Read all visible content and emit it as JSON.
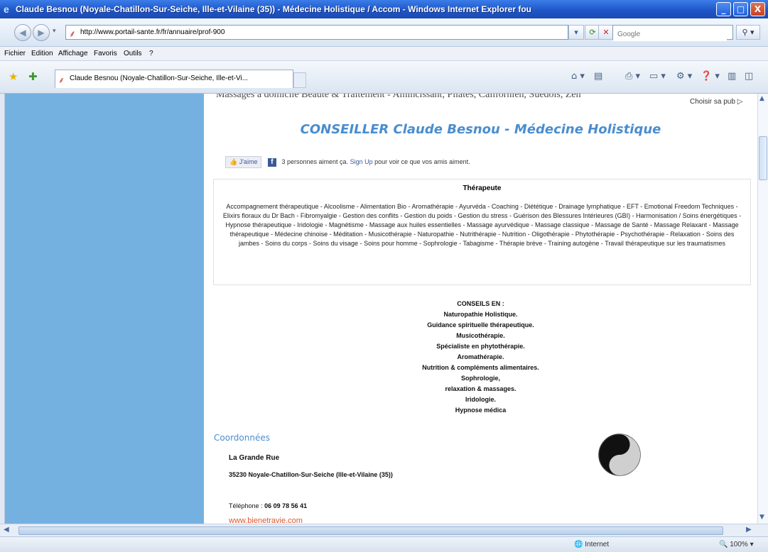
{
  "window": {
    "title": "Claude Besnou (Noyale-Chatillon-Sur-Seiche, Ille-et-Vilaine (35)) - Médecine Holistique / Accom - Windows Internet Explorer fou",
    "minimize": "_",
    "maximize": "□",
    "close": "X"
  },
  "address": {
    "url": "http://www.portail-sante.fr/fr/annuaire/prof-900",
    "search_placeholder": "Google"
  },
  "menu": [
    "Fichier",
    "Edition",
    "Affichage",
    "Favoris",
    "Outils",
    "?"
  ],
  "tab": {
    "label": "Claude Besnou (Noyale-Chatillon-Sur-Seiche, Ille-et-Vi..."
  },
  "ad": {
    "links": "Massages à domicile Beauté & Traitement - Amincissant, Pilates, Californien, Suédois, Zen",
    "choose": "Choisir sa pub ▷"
  },
  "page": {
    "heading": "CONSEILLER Claude Besnou - Médecine Holistique"
  },
  "facebook": {
    "like_button": "J'aime",
    "count_text": "3 personnes aiment ça.",
    "signup_link": "Sign Up",
    "suffix": "pour voir ce que vos amis aiment."
  },
  "therapeute": {
    "heading": "Thérapeute",
    "list": "Accompagnement thérapeutique - Alcoolisme - Alimentation Bio - Aromathérapie - Ayurvéda - Coaching - Diététique - Drainage lymphatique - EFT - Emotional Freedom Techniques - Elixirs floraux du Dr Bach - Fibromyalgie - Gestion des conflits - Gestion du poids - Gestion du stress - Guérison des Blessures Intérieures (GBI) - Harmonisation / Soins énergétiques - Hypnose thérapeutique - Iridologie - Magnétisme - Massage aux huiles essentielles - Massage ayurvédique - Massage classique - Massage de Santé - Massage Relaxant - Massage thérapeutique - Médecine chinoise - Méditation - Musicothérapie - Naturopathie - Nutrithérapie - Nutrition - Oligothérapie - Phytothérapie - Psychothérapie - Relaxation - Soins des jambes - Soins du corps - Soins du visage - Soins pour homme - Sophrologie - Tabagisme - Thérapie brève - Training autogène - Travail thérapeutique sur les traumatismes"
  },
  "conseils": {
    "lines": [
      "CONSEILS EN :",
      "Naturopathie Holistique.",
      "Guidance spirituelle thérapeutique.",
      "Musicothérapie.",
      "Spécialiste en phytothérapie.",
      "Aromathérapie.",
      "Nutrition & compléments alimentaires.",
      "Sophrologie,",
      "relaxation & massages.",
      "Iridologie.",
      "Hypnose médica"
    ]
  },
  "coordonnees": {
    "title": "Coordonnées",
    "street": "La Grande Rue",
    "city": "35230 Noyale-Chatillon-Sur-Seiche (Ille-et-Vilaine (35))",
    "phone_label": "Téléphone :",
    "phone": "06 09 78 56 41",
    "website": "www.bienetravie.com"
  },
  "status": {
    "zone": "Internet",
    "zoom": "100%"
  },
  "icons": {
    "back": "back-arrow-icon",
    "forward": "forward-arrow-icon",
    "refresh": "refresh-icon",
    "stop": "stop-icon",
    "search": "search-icon",
    "favorites": "favorites-star-icon",
    "add_favorites": "add-favorites-icon",
    "yin_yang": "yin-yang-icon"
  },
  "colors": {
    "sidebar": "#74b1e0",
    "heading": "#4a8dcf",
    "link_orange": "#e0552c",
    "titlebar": "#1f56c9"
  }
}
